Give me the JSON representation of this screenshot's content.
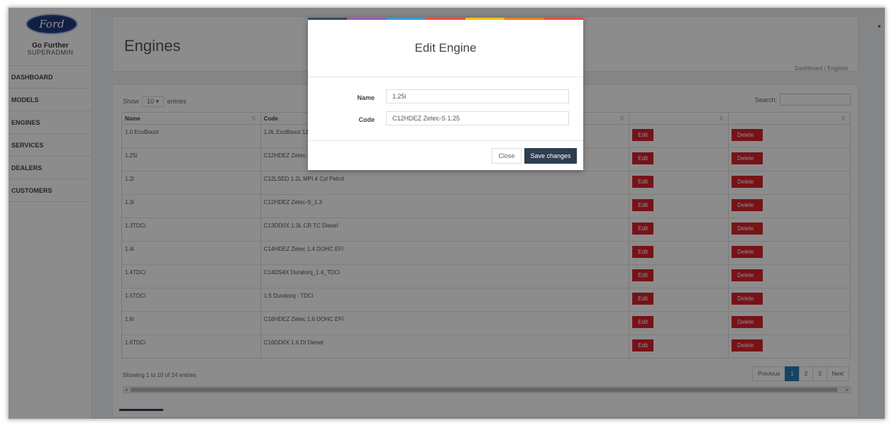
{
  "brand": {
    "logo_text": "Ford",
    "tagline": "Go Further",
    "role": "SUPERADMIN"
  },
  "sidebar": {
    "items": [
      {
        "label": "DASHBOARD"
      },
      {
        "label": "MODELS"
      },
      {
        "label": "ENGINES"
      },
      {
        "label": "SERVICES"
      },
      {
        "label": "DEALERS"
      },
      {
        "label": "CUSTOMERS"
      }
    ]
  },
  "header": {
    "title": "Engines",
    "breadcrumb": "Dashboard  /  Engines"
  },
  "table_controls": {
    "show_label": "Show",
    "page_size": "10",
    "entries_label": "entries",
    "search_label": "Search:"
  },
  "table": {
    "columns": [
      "Name",
      "Code",
      "",
      "",
      ""
    ],
    "rows": [
      {
        "name": "1.0 EcoBoost",
        "code": "1.0L EcoBoost 12",
        "edit": "Edit",
        "delete": "Delete"
      },
      {
        "name": "1.25i",
        "code": "C12HDEZ Zetec-",
        "edit": "Edit",
        "delete": "Delete"
      },
      {
        "name": "1.2i",
        "code": "C12LSED 1.2L MPI 4 Cyl Petrol",
        "edit": "Edit",
        "delete": "Delete"
      },
      {
        "name": "1.3i",
        "code": "C12HDEZ Zetec-S_1.3",
        "edit": "Edit",
        "delete": "Delete"
      },
      {
        "name": "1.3TDCi",
        "code": "C13DD0X 1.3L CR TC Diesel",
        "edit": "Edit",
        "delete": "Delete"
      },
      {
        "name": "1.4i",
        "code": "C14HDEZ Zetec 1.4 DOHC EFI",
        "edit": "Edit",
        "delete": "Delete"
      },
      {
        "name": "1.4TDCi",
        "code": "C14DS4X Duratorq_1.4_TDCi",
        "edit": "Edit",
        "delete": "Delete"
      },
      {
        "name": "1.5TDCi",
        "code": "1.5 Duratorq - TDCi",
        "edit": "Edit",
        "delete": "Delete"
      },
      {
        "name": "1.6i",
        "code": "C16HDEZ Zetec 1.6 DOHC EFI",
        "edit": "Edit",
        "delete": "Delete"
      },
      {
        "name": "1.6TDCi",
        "code": "C16DD0X 1.6 DI Diesel",
        "edit": "Edit",
        "delete": "Delete"
      }
    ],
    "info": "Showing 1 to 10 of 24 entries"
  },
  "pagination": {
    "previous": "Previous",
    "pages": [
      "1",
      "2",
      "3"
    ],
    "active_page": "1",
    "next": "Next"
  },
  "modal": {
    "title": "Edit Engine",
    "name_label": "Name",
    "name_value": "1.25i",
    "code_label": "Code",
    "code_value": "C12HDEZ Zetec-S 1.25",
    "close_label": "Close",
    "save_label": "Save changes"
  },
  "icons": {
    "sort": "sort-icon",
    "scroll_left": "scroll-left-icon",
    "scroll_right": "scroll-right-icon"
  },
  "colors": {
    "accent_red": "#d9232d",
    "primary_dark": "#2c3e50",
    "pagination_active": "#2b7bb9",
    "stripe": [
      "#34495e",
      "#9b59b6",
      "#3498db",
      "#e74c3c",
      "#f1c40f",
      "#e67e22",
      "#e74c3c"
    ]
  }
}
